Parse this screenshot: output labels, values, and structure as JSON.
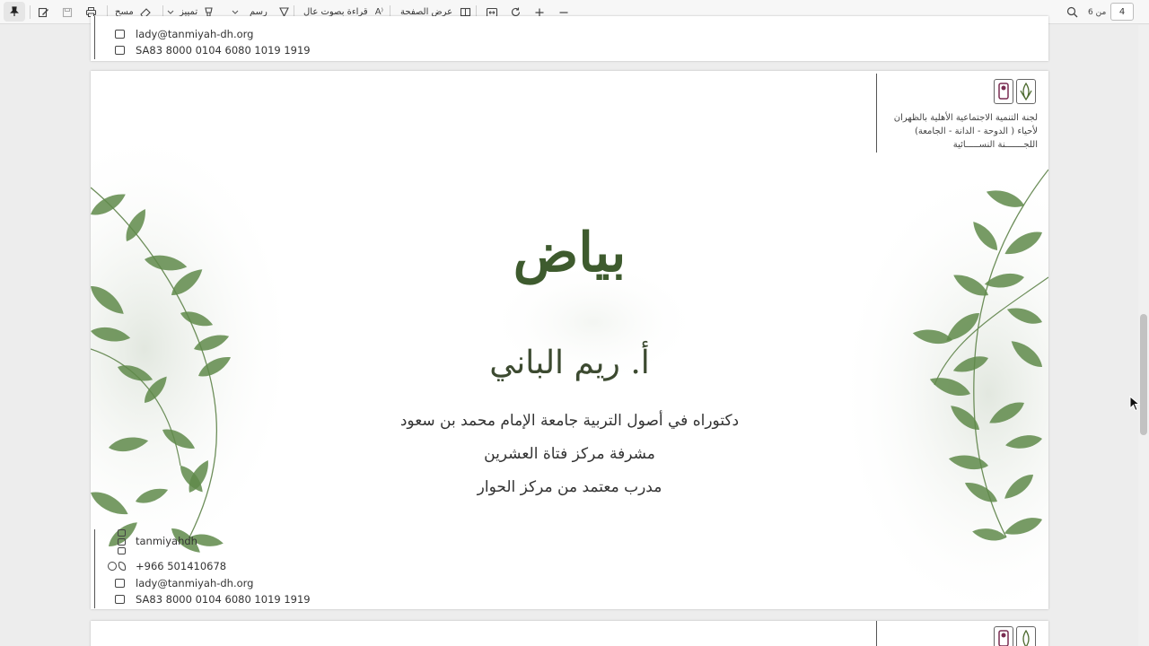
{
  "toolbar": {
    "erase_label": "مسح",
    "highlight_label": "تمييز",
    "draw_label": "رسم",
    "read_aloud_label": "قراءة بصوت عالٍ",
    "page_view_label": "عرض الصفحة",
    "page_current": "4",
    "page_total": "من 6"
  },
  "contact": {
    "social": "tanmiyahdh",
    "phone": "+966 501410678",
    "email": "lady@tanmiyah-dh.org",
    "iban": "SA83 8000 0104 6080 1019 1919"
  },
  "slide": {
    "title": "بياض",
    "presenter": "أ. ريم الباني",
    "line1": "دكتوراه في أصول التربية جامعة الإمام محمد بن سعود",
    "line2": "مشرفة مركز فتاة العشرين",
    "line3": "مدرب معتمد من مركز الحوار"
  },
  "org": {
    "line1": "لجنة التنمية الاجتماعية الأهلية بالظهران",
    "line2": "لأحياء ( الدوحة - الدانة - الجامعة)",
    "line3": "اللجـــــــنة النســـــائية"
  },
  "colors": {
    "leaf": "#5f8a4a",
    "title": "#3e5b2e"
  }
}
